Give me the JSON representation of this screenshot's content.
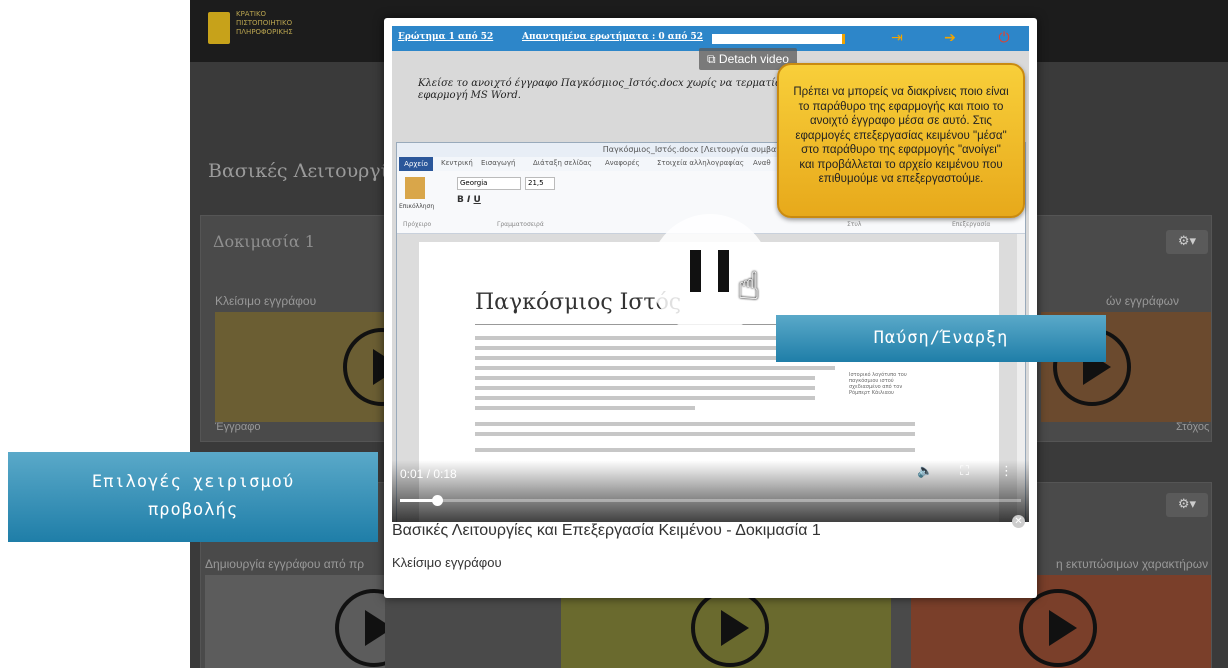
{
  "background": {
    "logo_lines": [
      "ΚΡΑΤΙΚΟ",
      "ΠΙΣΤΟΠΟΙΗΤΙΚΟ",
      "ΠΛΗΡΟΦΟΡΙΚΗΣ"
    ],
    "section_title": "Βασικές Λειτουργίε",
    "card_row1_title": "Δοκιμασία 1",
    "card_left_caption": "Κλείσιμο εγγράφου",
    "card_right_caption": "ών εγγράφων",
    "card_left_footer": "Έγγραφο",
    "card_right_footer": "Στόχος",
    "card_row2_left_caption": "Δημιουργία εγγράφου από πρ",
    "card_row2_right_caption": "η εκτυπώσιμων χαρακτήρων",
    "gear_label": "⚙▾"
  },
  "quiz": {
    "question": "Ερώτημα 1 από 52",
    "answered": "Απαντημένα ερωτήματα : 0 από 52"
  },
  "detach": {
    "label": "Detach video"
  },
  "instruction": "Κλείσε το ανοιχτό έγγραφο Παγκόσμιος_Ιστός.docx χωρίς να τερματίσεις την εφαρμογή MS Word.",
  "word": {
    "window_title": "Παγκόσμιος_Ιστός.docx [Λειτουργία συμβατότητας] -",
    "tabs": [
      "Αρχείο",
      "Κεντρική",
      "Εισαγωγή",
      "Διάταξη σελίδας",
      "Αναφορές",
      "Στοιχεία αλληλογραφίας",
      "Αναθ"
    ],
    "font_name": "Georgia",
    "font_size": "21,5",
    "groups": [
      "Πρόχειρο",
      "Γραμματοσειρά",
      "Στυλ",
      "Επεξεργασία"
    ],
    "paste_label": "Επικόλληση",
    "doc_heading": "Παγκόσμιος Ιστός",
    "side_note": "Ιστορικό λογότυπο του παγκόσμιου ιστού σχεδιασμένο από τον Ρόμπερτ Κάιλιαου"
  },
  "callout": {
    "text": "Πρέπει να μπορείς να διακρίνεις ποιο είναι το παράθυρο της εφαρμογής και ποιο το ανοιχτό έγγραφο μέσα σε αυτό. Στις εφαρμογές επεξεργασίας κειμένου \"μέσα\" στο παράθυρο της εφαρμογής \"ανοίγει\" και προβάλλεται το αρχείο κειμένου που επιθυμούμε να επεξεργαστούμε."
  },
  "player": {
    "time": "0:01 / 0:18",
    "progress": 0.06
  },
  "modal": {
    "title": "Βασικές Λειτουργίες και Επεξεργασία Κειμένου - Δοκιμασία 1",
    "subtitle": "Κλείσιμο εγγράφου",
    "close_glyph": "✕"
  },
  "labels": {
    "play_pause": "Παύση/Έναρξη",
    "view_options_line1": "Επιλογές χειρισμού",
    "view_options_line2": "προβολής"
  },
  "colors": {
    "quiz_bar": "#2d86c9",
    "callout": "#f2b92a",
    "label_box": "#3b95bd"
  }
}
